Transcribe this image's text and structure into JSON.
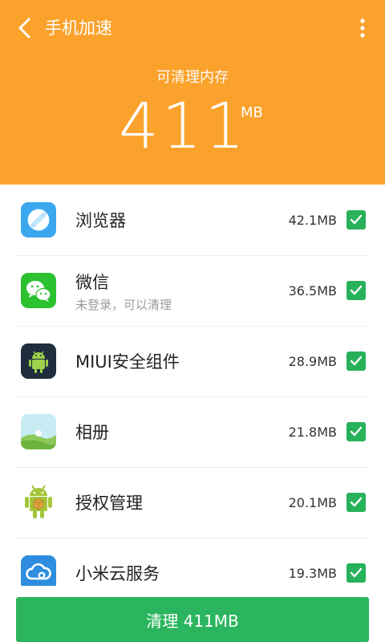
{
  "header": {
    "title": "手机加速",
    "subtitle": "可清理内存",
    "memory_value": "411",
    "memory_unit": "MB",
    "accent_color": "#fba22c"
  },
  "apps": [
    {
      "name": "浏览器",
      "sub": "",
      "size": "42.1MB",
      "checked": true,
      "icon": "browser-icon"
    },
    {
      "name": "微信",
      "sub": "未登录，可以清理",
      "size": "36.5MB",
      "checked": true,
      "icon": "wechat-icon"
    },
    {
      "name": "MIUI安全组件",
      "sub": "",
      "size": "28.9MB",
      "checked": true,
      "icon": "android-security-icon"
    },
    {
      "name": "相册",
      "sub": "",
      "size": "21.8MB",
      "checked": true,
      "icon": "gallery-icon"
    },
    {
      "name": "授权管理",
      "sub": "",
      "size": "20.1MB",
      "checked": true,
      "icon": "android-package-icon"
    },
    {
      "name": "小米云服务",
      "sub": "",
      "size": "19.3MB",
      "checked": true,
      "icon": "cloud-icon"
    }
  ],
  "clean_button": {
    "label": "清理 411MB",
    "color": "#2bb55e"
  }
}
